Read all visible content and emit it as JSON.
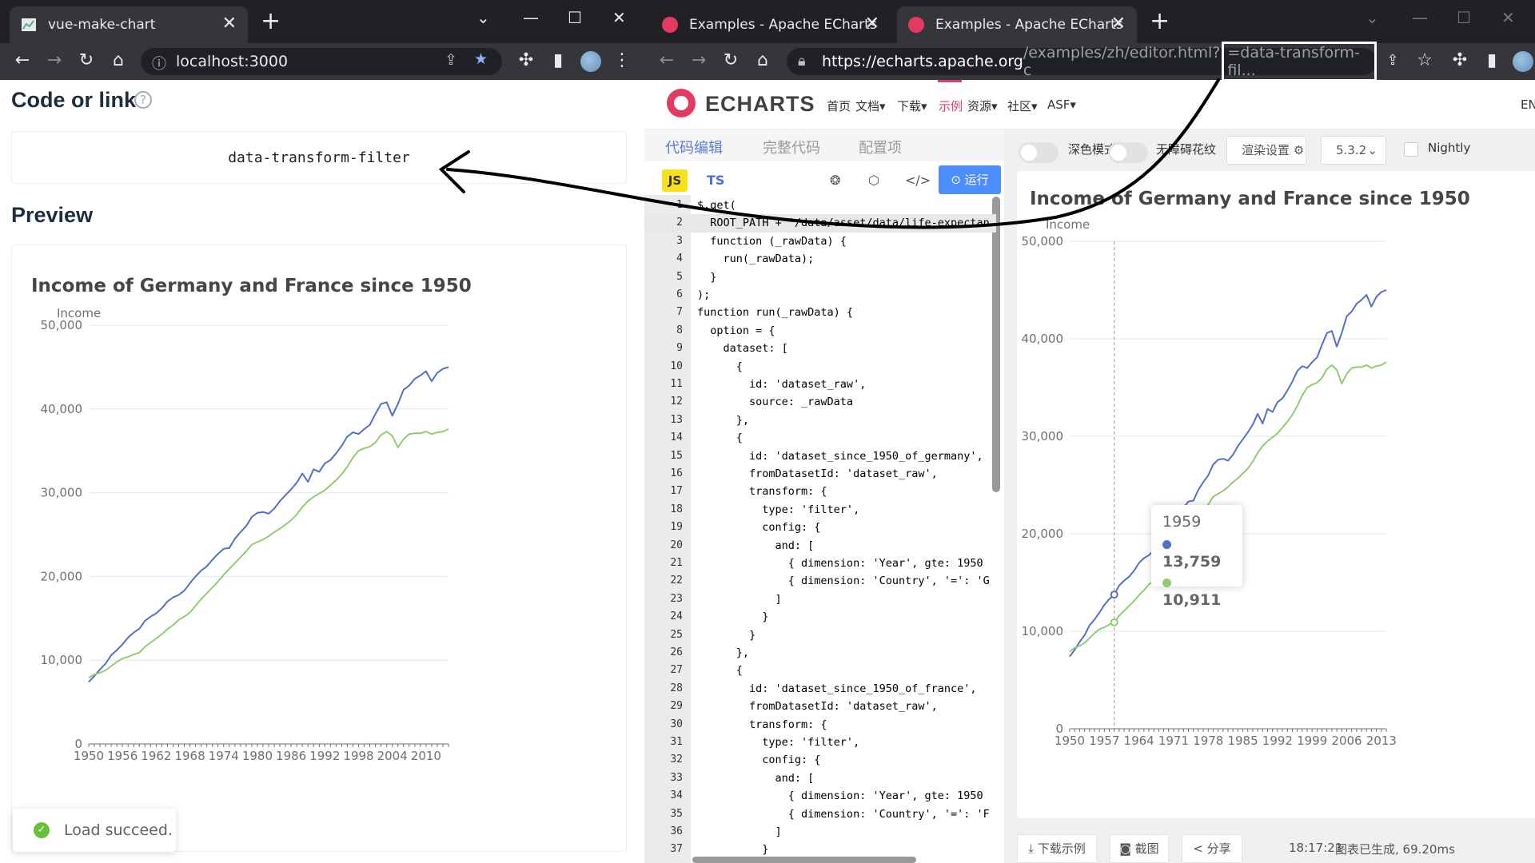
{
  "left_window": {
    "tab_title": "vue-make-chart",
    "url": "localhost:3000",
    "code_or_link_heading": "Code or link",
    "code_value": "data-transform-filter",
    "preview_heading": "Preview",
    "toast": "Load succeed."
  },
  "right_window": {
    "tabs": [
      {
        "title": "Examples - Apache ECharts"
      },
      {
        "title": "Examples - Apache ECharts"
      }
    ],
    "url_host": "https://echarts.apache.org",
    "url_path": "/examples/zh/editor.html?c",
    "url_highlight": "=data-transform-fil...",
    "logo_text": "ECHARTS",
    "nav": [
      "首页",
      "文档▾",
      "下载▾",
      "示例",
      "资源▾",
      "社区▾",
      "ASF▾"
    ],
    "nav_right": "EN",
    "editor_tabs": [
      "代码编辑",
      "完整代码",
      "配置项"
    ],
    "js_label": "JS",
    "ts_label": "TS",
    "run_label": "运行",
    "dark_mode_label": "深色模式",
    "accessibility_label": "无障碍花纹",
    "render_settings_label": "渲染设置",
    "version": "5.3.2",
    "nightly_label": "Nightly",
    "download_label": "下载示例",
    "screenshot_label": "截图",
    "share_label": "分享",
    "status_time": "18:17:21",
    "status_text": "图表已生成, 69.20ms",
    "code_lines": [
      "$.get(",
      "  ROOT_PATH + '/data/asset/data/life-expectan",
      "  function (_rawData) {",
      "    run(_rawData);",
      "  }",
      ");",
      "function run(_rawData) {",
      "  option = {",
      "    dataset: [",
      "      {",
      "        id: 'dataset_raw',",
      "        source: _rawData",
      "      },",
      "      {",
      "        id: 'dataset_since_1950_of_germany',",
      "        fromDatasetId: 'dataset_raw',",
      "        transform: {",
      "          type: 'filter',",
      "          config: {",
      "            and: [",
      "              { dimension: 'Year', gte: 1950",
      "              { dimension: 'Country', '=': 'G",
      "            ]",
      "          }",
      "        }",
      "      },",
      "      {",
      "        id: 'dataset_since_1950_of_france',",
      "        fromDatasetId: 'dataset_raw',",
      "        transform: {",
      "          type: 'filter',",
      "          config: {",
      "            and: [",
      "              { dimension: 'Year', gte: 1950",
      "              { dimension: 'Country', '=': 'F",
      "            ]",
      "          }"
    ],
    "tooltip": {
      "year": "1959",
      "values": [
        "13,759",
        "10,911"
      ]
    }
  },
  "chart_data": [
    {
      "type": "line",
      "title": "Income of Germany and France since 1950",
      "ylabel": "Income",
      "ylim": [
        0,
        50000
      ],
      "y_ticks": [
        "0",
        "10,000",
        "20,000",
        "30,000",
        "40,000",
        "50,000"
      ],
      "x_tick_labels": [
        "1950",
        "1956",
        "1962",
        "1968",
        "1974",
        "1980",
        "1986",
        "1992",
        "1998",
        "2004",
        "2010"
      ],
      "x_start": 1950,
      "x_end": 2014,
      "series": [
        {
          "color": "#5470c6",
          "values": [
            7400,
            8100,
            8900,
            9600,
            10600,
            11200,
            11900,
            12700,
            13300,
            13759,
            14700,
            15200,
            15600,
            16200,
            17000,
            17500,
            17800,
            18300,
            19200,
            20000,
            20700,
            21200,
            22000,
            22700,
            23300,
            23400,
            24500,
            25300,
            26000,
            27100,
            27600,
            27700,
            27500,
            28100,
            29000,
            29700,
            30400,
            31200,
            32300,
            31300,
            32800,
            32500,
            33500,
            33900,
            34700,
            35600,
            36700,
            37200,
            37000,
            37600,
            38100,
            39400,
            40600,
            40800,
            39200,
            40600,
            42300,
            42800,
            43600,
            44000,
            44500,
            43300,
            44300,
            44800,
            45000
          ]
        },
        {
          "color": "#91cc75",
          "values": [
            7900,
            8300,
            8500,
            8800,
            9300,
            9800,
            10200,
            10400,
            10700,
            10911,
            11600,
            12100,
            12600,
            13100,
            13700,
            14200,
            14800,
            15200,
            15700,
            16500,
            17300,
            18000,
            18700,
            19400,
            20200,
            20900,
            21600,
            22300,
            23000,
            23800,
            24100,
            24400,
            24800,
            25300,
            25700,
            26200,
            26700,
            27400,
            28300,
            29000,
            29500,
            29900,
            30300,
            30900,
            31500,
            32200,
            33100,
            34200,
            35000,
            35300,
            35500,
            36000,
            36900,
            37300,
            36800,
            35400,
            36400,
            37000,
            37100,
            37100,
            37300,
            37000,
            37200,
            37300,
            37600
          ]
        }
      ]
    },
    {
      "type": "line",
      "title": "Income of Germany and France since 1950",
      "ylabel": "Income",
      "ylim": [
        0,
        50000
      ],
      "y_ticks": [
        "0",
        "10,000",
        "20,000",
        "30,000",
        "40,000",
        "50,000"
      ],
      "x_tick_labels": [
        "1950",
        "1957",
        "1964",
        "1971",
        "1978",
        "1985",
        "1992",
        "1999",
        "2006",
        "2013"
      ],
      "x_start": 1950,
      "x_end": 2014,
      "series": [
        {
          "color": "#5470c6",
          "values": [
            7400,
            8100,
            8900,
            9600,
            10600,
            11200,
            11900,
            12700,
            13300,
            13759,
            14700,
            15200,
            15600,
            16200,
            17000,
            17500,
            17800,
            18300,
            19200,
            20000,
            20700,
            21200,
            22000,
            22700,
            23300,
            23400,
            24500,
            25300,
            26000,
            27100,
            27600,
            27700,
            27500,
            28100,
            29000,
            29700,
            30400,
            31200,
            32300,
            31300,
            32800,
            32500,
            33500,
            33900,
            34700,
            35600,
            36700,
            37200,
            37000,
            37600,
            38100,
            39400,
            40600,
            40800,
            39200,
            40600,
            42300,
            42800,
            43600,
            44000,
            44500,
            43300,
            44300,
            44800,
            45000
          ]
        },
        {
          "color": "#91cc75",
          "values": [
            7900,
            8300,
            8500,
            8800,
            9300,
            9800,
            10200,
            10400,
            10700,
            10911,
            11600,
            12100,
            12600,
            13100,
            13700,
            14200,
            14800,
            15200,
            15700,
            16500,
            17300,
            18000,
            18700,
            19400,
            20200,
            20900,
            21600,
            22300,
            23000,
            23800,
            24100,
            24400,
            24800,
            25300,
            25700,
            26200,
            26700,
            27400,
            28300,
            29000,
            29500,
            29900,
            30300,
            30900,
            31500,
            32200,
            33100,
            34200,
            35000,
            35300,
            35500,
            36000,
            36900,
            37300,
            36800,
            35400,
            36400,
            37000,
            37100,
            37100,
            37300,
            37000,
            37200,
            37300,
            37600
          ]
        }
      ],
      "tooltip_x": 1959
    }
  ]
}
